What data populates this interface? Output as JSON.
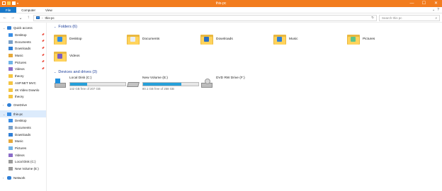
{
  "window": {
    "title": "this-pc",
    "controls": {
      "minimize": "—",
      "maximize": "☐",
      "close": "✕"
    }
  },
  "ribbon": {
    "tabs": [
      "File",
      "Computer",
      "View"
    ],
    "expand_icon": "chevron-down-icon",
    "help_icon": "question-icon"
  },
  "address": {
    "back": "←",
    "forward": "→",
    "recent": "⌄",
    "up": "↑",
    "path": "this-pc",
    "refresh": "↻",
    "search_placeholder": "Search this pc"
  },
  "sidebar": {
    "quick_access": "Quick access",
    "quick_items": [
      {
        "label": "Desktop",
        "icon": "desktop-icon",
        "color": "#3a8ee6",
        "pinned": true
      },
      {
        "label": "Documents",
        "icon": "documents-icon",
        "color": "#7aa0c8",
        "pinned": true
      },
      {
        "label": "Downloads",
        "icon": "downloads-icon",
        "color": "#2f7fd6",
        "pinned": true
      },
      {
        "label": "Music",
        "icon": "music-icon",
        "color": "#e6a93a",
        "pinned": true
      },
      {
        "label": "Pictures",
        "icon": "pictures-icon",
        "color": "#6fb4e8",
        "pinned": true
      },
      {
        "label": "Videos",
        "icon": "videos-icon",
        "color": "#8a6cc8",
        "pinned": true
      },
      {
        "label": "theory",
        "icon": "folder-icon",
        "color": "#f4c542",
        "pinned": false
      },
      {
        "label": "ASP.NET MVC",
        "icon": "folder-icon",
        "color": "#f4c542",
        "pinned": false
      },
      {
        "label": "4K Video Downlo",
        "icon": "folder-icon",
        "color": "#f4c542",
        "pinned": false
      },
      {
        "label": "theory",
        "icon": "folder-icon",
        "color": "#f4c542",
        "pinned": false
      }
    ],
    "onedrive": "OneDrive",
    "this_pc": "this-pc",
    "pc_items": [
      {
        "label": "Desktop",
        "icon": "desktop-icon",
        "color": "#3a8ee6"
      },
      {
        "label": "Documents",
        "icon": "documents-icon",
        "color": "#7aa0c8"
      },
      {
        "label": "Downloads",
        "icon": "downloads-icon",
        "color": "#2f7fd6"
      },
      {
        "label": "Music",
        "icon": "music-icon",
        "color": "#e6a93a"
      },
      {
        "label": "Pictures",
        "icon": "pictures-icon",
        "color": "#6fb4e8"
      },
      {
        "label": "Videos",
        "icon": "videos-icon",
        "color": "#8a6cc8"
      },
      {
        "label": "Local Disk (C:)",
        "icon": "windows-drive-icon",
        "color": "#9a9a9a"
      },
      {
        "label": "New Volume (E:)",
        "icon": "drive-icon",
        "color": "#9a9a9a"
      }
    ],
    "network": "Network"
  },
  "folders": {
    "header": "Folders (6)",
    "items": [
      {
        "label": "Desktop",
        "icon": "desktop-folder-icon",
        "badge": "#2f8ee8"
      },
      {
        "label": "Documents",
        "icon": "documents-folder-icon",
        "badge": "#e8eef6"
      },
      {
        "label": "Downloads",
        "icon": "downloads-folder-icon",
        "badge": "#2c6fc0"
      },
      {
        "label": "Music",
        "icon": "music-folder-icon",
        "badge": "#2f7fd6"
      },
      {
        "label": "Pictures",
        "icon": "pictures-folder-icon",
        "badge": "#5fc48a"
      },
      {
        "label": "Videos",
        "icon": "videos-folder-icon",
        "badge": "#7a5cc4"
      }
    ]
  },
  "drives": {
    "header": "Devices and drives (3)",
    "items": [
      {
        "label": "Local Disk (C:)",
        "icon": "windows-drive-icon",
        "free": "142 GB free of 207 GB",
        "used_fraction": 0.31
      },
      {
        "label": "New Volume (E:)",
        "icon": "drive-icon",
        "free": "80.1 GB free of 258 GB",
        "used_fraction": 0.69
      },
      {
        "label": "DVD RW Drive (F:)",
        "icon": "dvd-drive-icon"
      }
    ]
  },
  "colors": {
    "titlebar": "#f27c1e",
    "file_tab": "#1979ca",
    "section_header": "#1e3f9a",
    "capacity_fill": "#26a0da"
  }
}
